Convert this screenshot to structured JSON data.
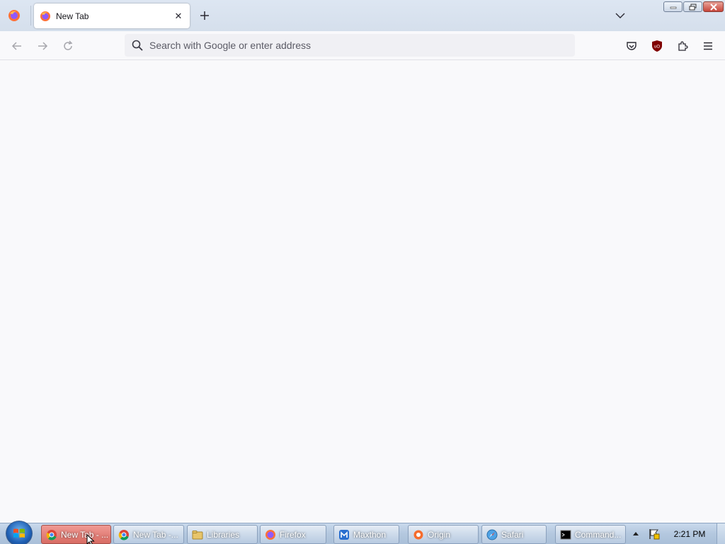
{
  "browser": {
    "tab": {
      "title": "New Tab"
    },
    "urlbar": {
      "placeholder": "Search with Google or enter address"
    }
  },
  "taskbar": {
    "items": [
      {
        "label": "New Tab - ...",
        "icon": "chrome-icon",
        "active": true
      },
      {
        "label": "New Tab -...",
        "icon": "chrome-icon"
      },
      {
        "label": "Libraries",
        "icon": "folder-icon"
      },
      {
        "label": "Firefox",
        "icon": "firefox-icon"
      },
      {
        "label": "Maxthon",
        "icon": "maxthon-icon"
      },
      {
        "label": "Origin",
        "icon": "origin-icon"
      },
      {
        "label": "Safari",
        "icon": "safari-icon"
      },
      {
        "label": "Command...",
        "icon": "cmd-icon"
      }
    ],
    "clock": "2:21 PM"
  },
  "colors": {
    "accent_active_task": "#d86b63",
    "ublock_red": "#800000"
  }
}
